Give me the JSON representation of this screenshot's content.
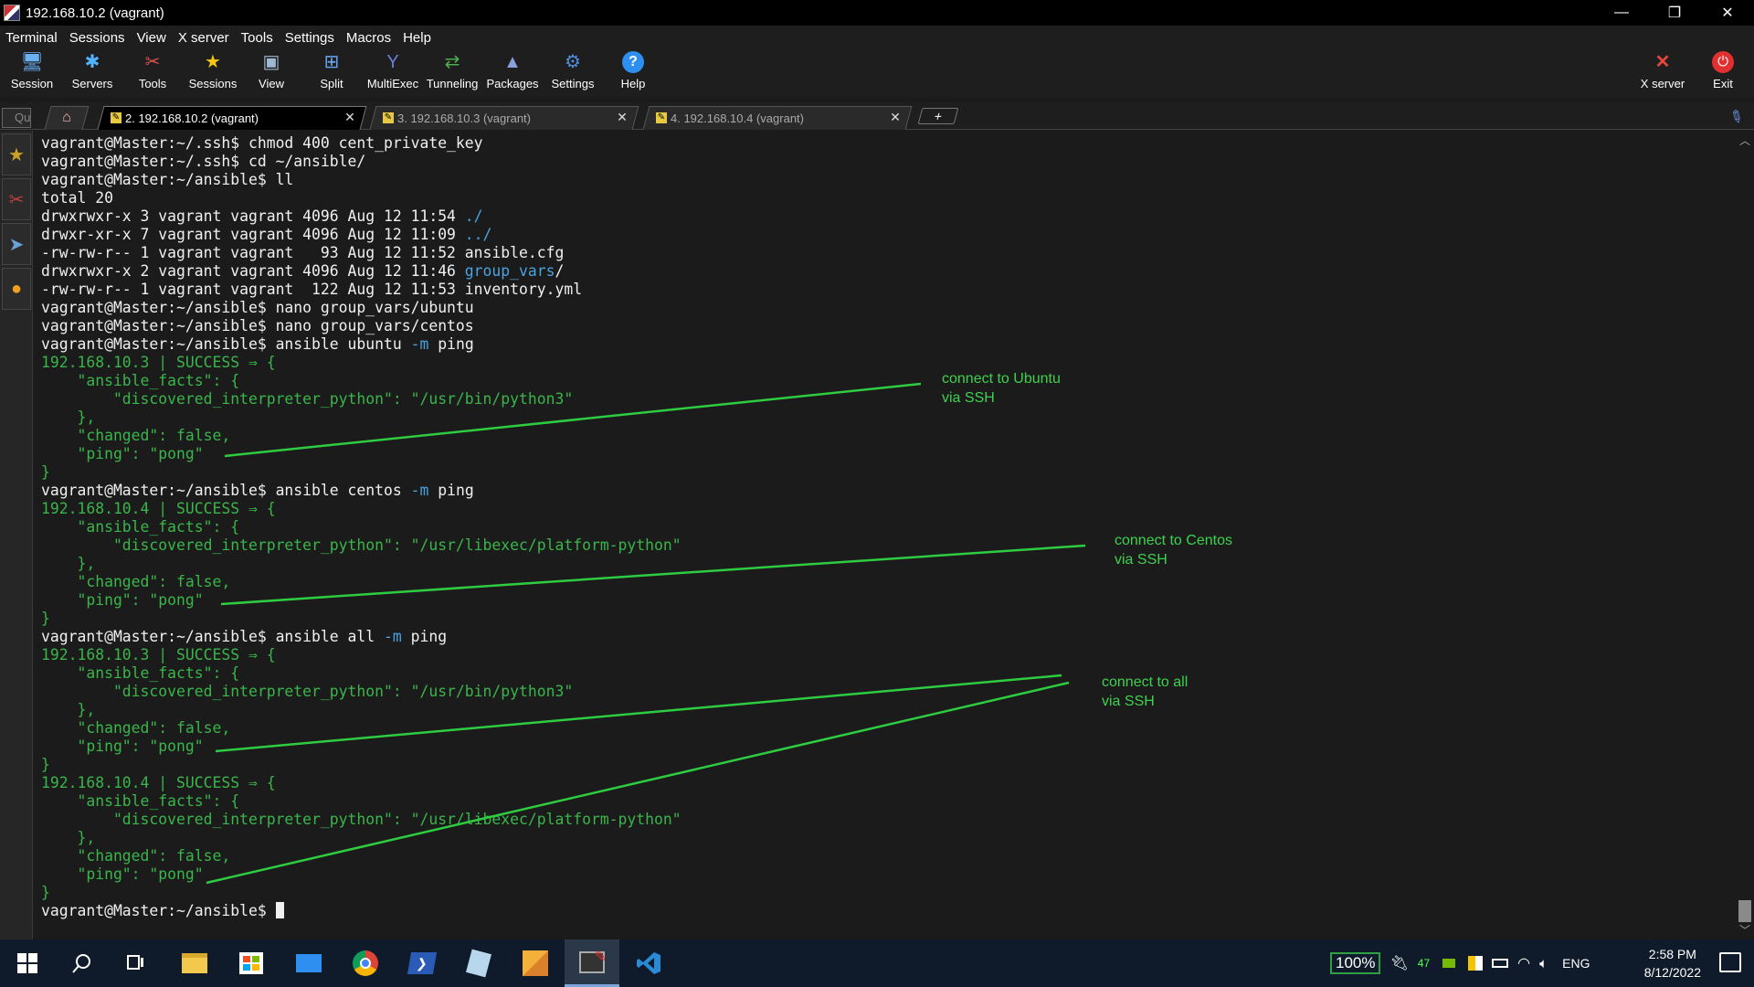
{
  "window": {
    "title": "192.168.10.2 (vagrant)",
    "minimize": "—",
    "restore": "❐",
    "close": "✕"
  },
  "menu": [
    "Terminal",
    "Sessions",
    "View",
    "X server",
    "Tools",
    "Settings",
    "Macros",
    "Help"
  ],
  "toolbar": {
    "items": [
      {
        "label": "Session",
        "icon": "session-icon",
        "glyph": "🖥",
        "color": "#6ab0f3"
      },
      {
        "label": "Servers",
        "icon": "servers-icon",
        "glyph": "✱",
        "color": "#4fb3ff"
      },
      {
        "label": "Tools",
        "icon": "tools-icon",
        "glyph": "✂",
        "color": "#e05050"
      },
      {
        "label": "Sessions",
        "icon": "star-icon",
        "glyph": "★",
        "color": "#f5c518"
      },
      {
        "label": "View",
        "icon": "view-icon",
        "glyph": "▣",
        "color": "#9fb7d1"
      },
      {
        "label": "Split",
        "icon": "split-icon",
        "glyph": "⊞",
        "color": "#6aa7f0"
      },
      {
        "label": "MultiExec",
        "icon": "multiexec-icon",
        "glyph": "Y",
        "color": "#6a7fe0"
      },
      {
        "label": "Tunneling",
        "icon": "tunneling-icon",
        "glyph": "⇄",
        "color": "#4caf50"
      },
      {
        "label": "Packages",
        "icon": "packages-icon",
        "glyph": "▲",
        "color": "#8aa0d8"
      },
      {
        "label": "Settings",
        "icon": "gear-icon",
        "glyph": "⚙",
        "color": "#4f8fe0"
      },
      {
        "label": "Help",
        "icon": "help-icon",
        "glyph": "?",
        "color": "#ffffff"
      }
    ],
    "xserver": {
      "label": "X server",
      "glyph": "✕"
    },
    "exit": {
      "label": "Exit",
      "glyph": "⏻"
    }
  },
  "quick_connect_placeholder": "Qu",
  "tabs": [
    {
      "label": "2. 192.168.10.2 (vagrant)",
      "active": true
    },
    {
      "label": "3. 192.168.10.3 (vagrant)",
      "active": false
    },
    {
      "label": "4. 192.168.10.4 (vagrant)",
      "active": false
    }
  ],
  "terminal": {
    "lines": [
      [
        {
          "t": "vagrant@Master:~/.ssh$ chmod 400 cent_private_key"
        }
      ],
      [
        {
          "t": "vagrant@Master:~/.ssh$ cd ~/ansible/"
        }
      ],
      [
        {
          "t": "vagrant@Master:~/ansible$ ll"
        }
      ],
      [
        {
          "t": "total 20"
        }
      ],
      [
        {
          "t": "drwxrwxr-x 3 vagrant vagrant 4096 Aug 12 11:54 "
        },
        {
          "t": "./",
          "c": "c-blue"
        }
      ],
      [
        {
          "t": "drwxr-xr-x 7 vagrant vagrant 4096 Aug 12 11:09 "
        },
        {
          "t": "../",
          "c": "c-blue"
        }
      ],
      [
        {
          "t": "-rw-rw-r-- 1 vagrant vagrant   93 Aug 12 11:52 ansible.cfg"
        }
      ],
      [
        {
          "t": "drwxrwxr-x 2 vagrant vagrant 4096 Aug 12 11:46 "
        },
        {
          "t": "group_vars",
          "c": "c-blue"
        },
        {
          "t": "/"
        }
      ],
      [
        {
          "t": "-rw-rw-r-- 1 vagrant vagrant  122 Aug 12 11:53 inventory.yml"
        }
      ],
      [
        {
          "t": "vagrant@Master:~/ansible$ nano group_vars/ubuntu"
        }
      ],
      [
        {
          "t": "vagrant@Master:~/ansible$ nano group_vars/centos"
        }
      ],
      [
        {
          "t": "vagrant@Master:~/ansible$ ansible ubuntu "
        },
        {
          "t": "-m",
          "c": "c-blue"
        },
        {
          "t": " ping"
        }
      ],
      [
        {
          "t": "192.168.10.3 | SUCCESS ⇒ {",
          "c": "c-green"
        }
      ],
      [
        {
          "t": "    \"ansible_facts\": {",
          "c": "c-green"
        }
      ],
      [
        {
          "t": "        \"discovered_interpreter_python\": \"/usr/bin/python3\"",
          "c": "c-green"
        }
      ],
      [
        {
          "t": "    },",
          "c": "c-green"
        }
      ],
      [
        {
          "t": "    \"changed\": false,",
          "c": "c-green"
        }
      ],
      [
        {
          "t": "    \"ping\": \"pong\"",
          "c": "c-green"
        }
      ],
      [
        {
          "t": "}",
          "c": "c-green"
        }
      ],
      [
        {
          "t": "vagrant@Master:~/ansible$ ansible centos "
        },
        {
          "t": "-m",
          "c": "c-blue"
        },
        {
          "t": " ping"
        }
      ],
      [
        {
          "t": "192.168.10.4 | SUCCESS ⇒ {",
          "c": "c-green"
        }
      ],
      [
        {
          "t": "    \"ansible_facts\": {",
          "c": "c-green"
        }
      ],
      [
        {
          "t": "        \"discovered_interpreter_python\": \"/usr/libexec/platform-python\"",
          "c": "c-green"
        }
      ],
      [
        {
          "t": "    },",
          "c": "c-green"
        }
      ],
      [
        {
          "t": "    \"changed\": false,",
          "c": "c-green"
        }
      ],
      [
        {
          "t": "    \"ping\": \"pong\"",
          "c": "c-green"
        }
      ],
      [
        {
          "t": "}",
          "c": "c-green"
        }
      ],
      [
        {
          "t": "vagrant@Master:~/ansible$ ansible all "
        },
        {
          "t": "-m",
          "c": "c-blue"
        },
        {
          "t": " ping"
        }
      ],
      [
        {
          "t": "192.168.10.3 | SUCCESS ⇒ {",
          "c": "c-green"
        }
      ],
      [
        {
          "t": "    \"ansible_facts\": {",
          "c": "c-green"
        }
      ],
      [
        {
          "t": "        \"discovered_interpreter_python\": \"/usr/bin/python3\"",
          "c": "c-green"
        }
      ],
      [
        {
          "t": "    },",
          "c": "c-green"
        }
      ],
      [
        {
          "t": "    \"changed\": false,",
          "c": "c-green"
        }
      ],
      [
        {
          "t": "    \"ping\": \"pong\"",
          "c": "c-green"
        }
      ],
      [
        {
          "t": "}",
          "c": "c-green"
        }
      ],
      [
        {
          "t": "192.168.10.4 | SUCCESS ⇒ {",
          "c": "c-green"
        }
      ],
      [
        {
          "t": "    \"ansible_facts\": {",
          "c": "c-green"
        }
      ],
      [
        {
          "t": "        \"discovered_interpreter_python\": \"/usr/libexec/platform-python\"",
          "c": "c-green"
        }
      ],
      [
        {
          "t": "    },",
          "c": "c-green"
        }
      ],
      [
        {
          "t": "    \"changed\": false,",
          "c": "c-green"
        }
      ],
      [
        {
          "t": "    \"ping\": \"pong\"",
          "c": "c-green"
        }
      ],
      [
        {
          "t": "}",
          "c": "c-green"
        }
      ],
      [
        {
          "t": "vagrant@Master:~/ansible$ "
        }
      ]
    ]
  },
  "annotations": {
    "ubuntu": "connect to Ubuntu\nvia SSH",
    "centos": "connect to Centos\nvia SSH",
    "all": "connect to all\nvia SSH",
    "line_color": "#2ecc40"
  },
  "taskbar": {
    "battery": "100%",
    "badge": "47",
    "language": "ENG",
    "time": "2:58 PM",
    "date": "8/12/2022"
  }
}
